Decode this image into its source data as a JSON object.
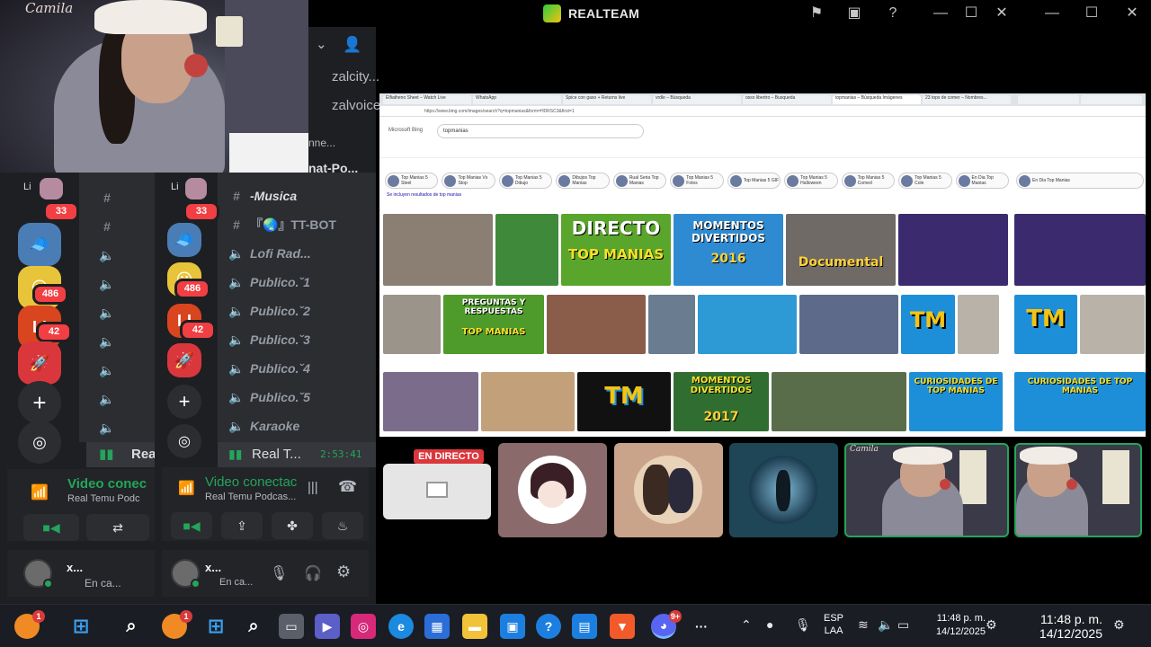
{
  "window": {
    "app_title": "REALTEAM",
    "buttons": [
      "flag-icon",
      "display-icon",
      "help-icon",
      "minimize",
      "maximize",
      "close"
    ]
  },
  "webcam": {
    "signature": "Camila"
  },
  "server_list": {
    "badges": [
      "33",
      "486",
      "42"
    ],
    "folder_label": "Li"
  },
  "channel_header": {
    "partial_lines": [
      "zalcity...",
      "zalvoice",
      "nne...",
      "nat-Po..."
    ]
  },
  "channels": [
    {
      "icon": "#",
      "label": "-Musica"
    },
    {
      "icon": "#",
      "label": "『🌏』TT-BOT"
    },
    {
      "icon": "speaker",
      "label": "Lofi Rad..."
    },
    {
      "icon": "speaker",
      "label": "Publico.ˇ1"
    },
    {
      "icon": "speaker",
      "label": "Publico.ˇ2"
    },
    {
      "icon": "speaker",
      "label": "Publico.ˇ3"
    },
    {
      "icon": "speaker",
      "label": "Publico.ˇ4"
    },
    {
      "icon": "speaker",
      "label": "Publico.ˇ5"
    },
    {
      "icon": "speaker",
      "label": "Karaoke"
    }
  ],
  "active_call": {
    "channel": "Real T...",
    "channel_left": "Rea",
    "duration": "2:53:41",
    "status_left": "Video conec",
    "status": "Video conectac",
    "server_left": "Real Temu Podc",
    "server": "Real Temu Podcas..."
  },
  "user": {
    "name": "x...",
    "status": "En ca..."
  },
  "browser": {
    "tabs": [
      "Elfiatheno Sheet – Watch Live",
      "WhatsApp",
      "Spice con gaso + Returns live",
      "vrdle – Búsqueda",
      "osso libertro – Busqueda",
      "topmanias – Búsqueda Imágenes",
      "23 tops de comer – Nombres..."
    ],
    "url": "https://www.bing.com/images/search?q=topmanias&form=HDRSC3&first=1",
    "search_query": "topmanias",
    "pills": [
      "Top Manias 5 Steel",
      "Top Manias Vs Stop",
      "Top Manias 5 Dibujo",
      "Dibujos Top Manias",
      "Rual Seria Top Manias",
      "Top Manias 5 Fotos",
      "Top Manias 5 GIF",
      "Top Manias 5 Halloween",
      "Top Manias 5 Comed",
      "Top Manias 5 Cole",
      "En Dia Top Manias"
    ],
    "suggestion": "Se incluyen resultados de top manias",
    "thumb_texts": [
      "DIRECTO",
      "TOP MANIAS",
      "MOMENTOS DIVERTIDOS",
      "2016",
      "Documental",
      "PREGUNTAS Y RESPUESTAS",
      "TOP MANIAS",
      "TM",
      "MOMENTOS DIVERTIDOS",
      "2017",
      "CURIOSIDADES DE TOP MANIAS"
    ]
  },
  "participants": {
    "live_label": "EN DIRECTO"
  },
  "taskbar": {
    "badges": [
      "1",
      "1",
      "9+"
    ],
    "lang_line1": "ESP",
    "lang_line2": "LAA",
    "time": "11:48 p. m.",
    "date": "14/12/2025"
  },
  "colors": {
    "discord_bg": "#1e1f22",
    "channel_bg": "#2b2d31",
    "voice_green": "#23a55a",
    "badge_red": "#f23f43",
    "live_red": "#da373c",
    "bing_blue": "#1a0dab"
  }
}
